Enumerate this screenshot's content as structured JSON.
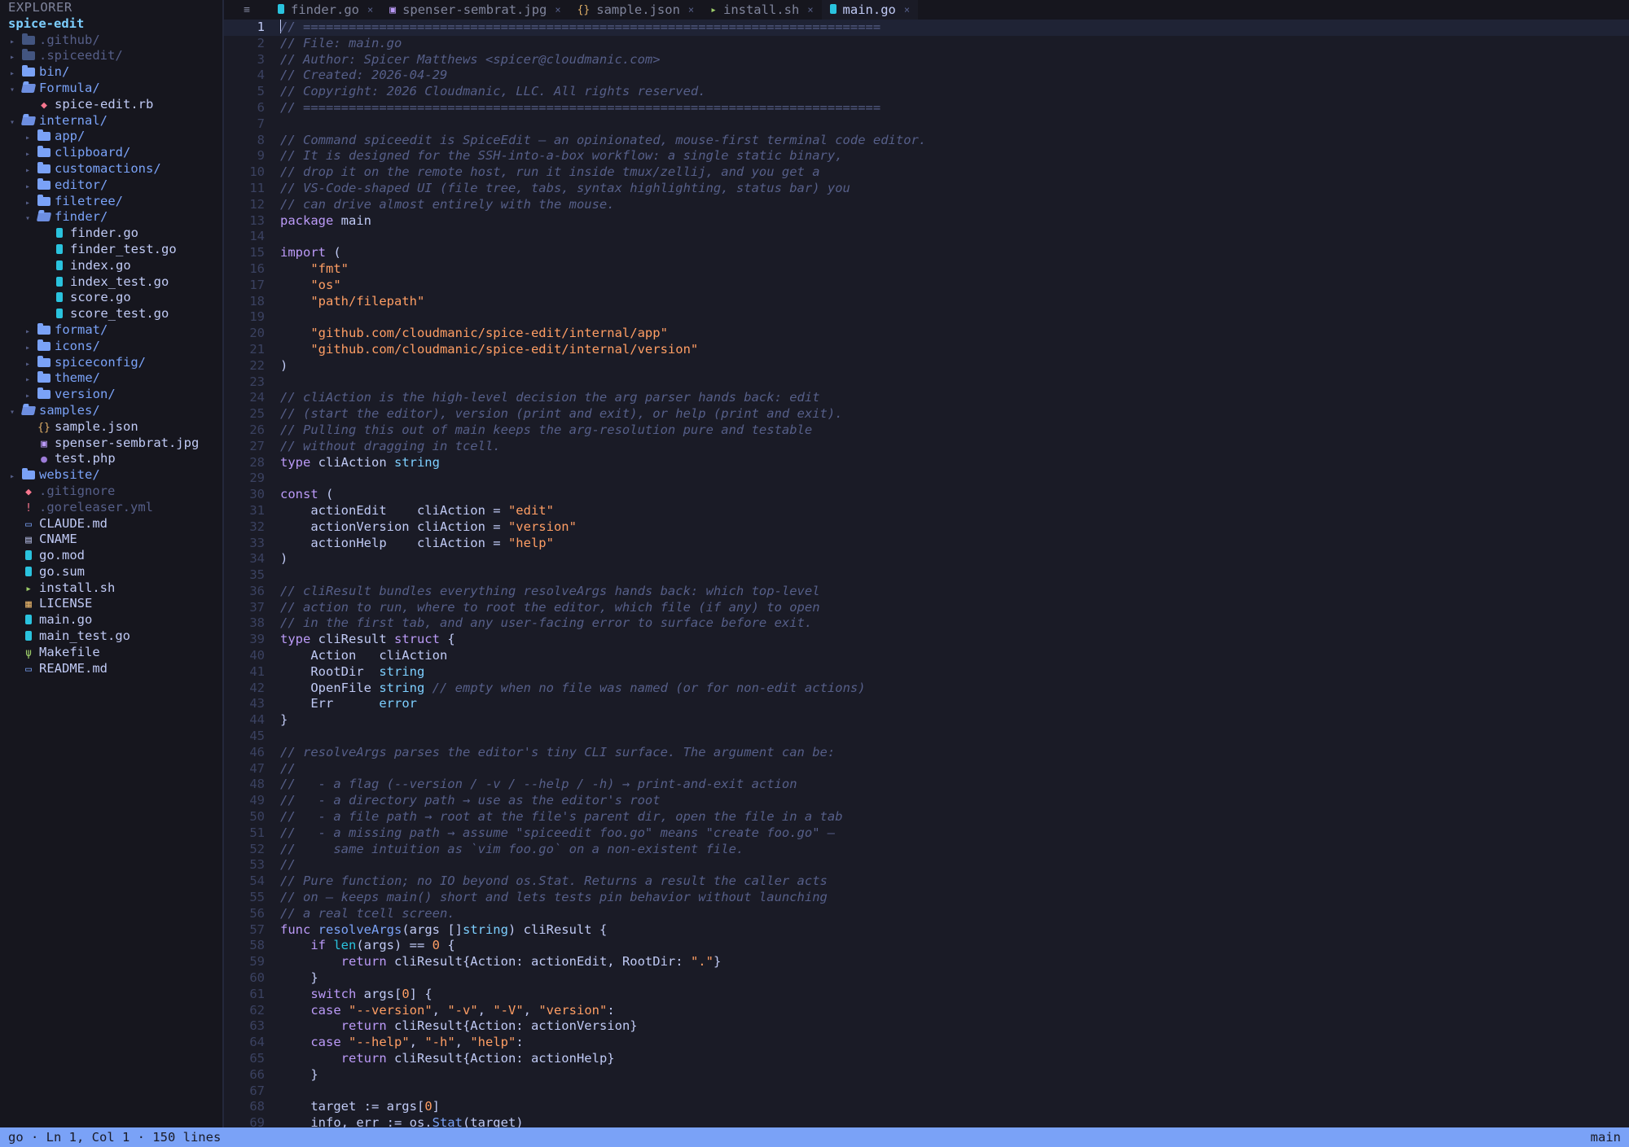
{
  "explorer": {
    "title": "EXPLORER",
    "root": "spice-edit",
    "items": [
      {
        "label": ".github/",
        "kind": "dir",
        "depth": 0,
        "open": false,
        "dim": true
      },
      {
        "label": ".spiceedit/",
        "kind": "dir",
        "depth": 0,
        "open": false,
        "dim": true
      },
      {
        "label": "bin/",
        "kind": "dir",
        "depth": 0,
        "open": false
      },
      {
        "label": "Formula/",
        "kind": "dir",
        "depth": 0,
        "open": true
      },
      {
        "label": "spice-edit.rb",
        "kind": "file",
        "depth": 1,
        "icon": "ruby-icon",
        "color": "#f7768e"
      },
      {
        "label": "internal/",
        "kind": "dir",
        "depth": 0,
        "open": true
      },
      {
        "label": "app/",
        "kind": "dir",
        "depth": 1,
        "open": false
      },
      {
        "label": "clipboard/",
        "kind": "dir",
        "depth": 1,
        "open": false
      },
      {
        "label": "customactions/",
        "kind": "dir",
        "depth": 1,
        "open": false
      },
      {
        "label": "editor/",
        "kind": "dir",
        "depth": 1,
        "open": false
      },
      {
        "label": "filetree/",
        "kind": "dir",
        "depth": 1,
        "open": false
      },
      {
        "label": "finder/",
        "kind": "dir",
        "depth": 1,
        "open": true
      },
      {
        "label": "finder.go",
        "kind": "file",
        "depth": 2,
        "icon": "go-icon",
        "color": "#2ac3de"
      },
      {
        "label": "finder_test.go",
        "kind": "file",
        "depth": 2,
        "icon": "go-icon",
        "color": "#2ac3de"
      },
      {
        "label": "index.go",
        "kind": "file",
        "depth": 2,
        "icon": "go-icon",
        "color": "#2ac3de"
      },
      {
        "label": "index_test.go",
        "kind": "file",
        "depth": 2,
        "icon": "go-icon",
        "color": "#2ac3de"
      },
      {
        "label": "score.go",
        "kind": "file",
        "depth": 2,
        "icon": "go-icon",
        "color": "#2ac3de"
      },
      {
        "label": "score_test.go",
        "kind": "file",
        "depth": 2,
        "icon": "go-icon",
        "color": "#2ac3de"
      },
      {
        "label": "format/",
        "kind": "dir",
        "depth": 1,
        "open": false
      },
      {
        "label": "icons/",
        "kind": "dir",
        "depth": 1,
        "open": false
      },
      {
        "label": "spiceconfig/",
        "kind": "dir",
        "depth": 1,
        "open": false
      },
      {
        "label": "theme/",
        "kind": "dir",
        "depth": 1,
        "open": false
      },
      {
        "label": "version/",
        "kind": "dir",
        "depth": 1,
        "open": false
      },
      {
        "label": "samples/",
        "kind": "dir",
        "depth": 0,
        "open": true
      },
      {
        "label": "sample.json",
        "kind": "file",
        "depth": 1,
        "icon": "json-icon",
        "color": "#e0af68"
      },
      {
        "label": "spenser-sembrat.jpg",
        "kind": "file",
        "depth": 1,
        "icon": "image-icon",
        "color": "#bb9af7"
      },
      {
        "label": "test.php",
        "kind": "file",
        "depth": 1,
        "icon": "php-icon",
        "color": "#9d7cd8"
      },
      {
        "label": "website/",
        "kind": "dir",
        "depth": 0,
        "open": false
      },
      {
        "label": ".gitignore",
        "kind": "file",
        "depth": 0,
        "icon": "git-icon",
        "color": "#f7768e",
        "dim": true
      },
      {
        "label": ".goreleaser.yml",
        "kind": "file",
        "depth": 0,
        "icon": "yaml-icon",
        "color": "#f7768e",
        "dim": true
      },
      {
        "label": "CLAUDE.md",
        "kind": "file",
        "depth": 0,
        "icon": "markdown-icon",
        "color": "#7aa2f7"
      },
      {
        "label": "CNAME",
        "kind": "file",
        "depth": 0,
        "icon": "file-icon",
        "color": "#a9b1d6"
      },
      {
        "label": "go.mod",
        "kind": "file",
        "depth": 0,
        "icon": "go-icon",
        "color": "#2ac3de"
      },
      {
        "label": "go.sum",
        "kind": "file",
        "depth": 0,
        "icon": "go-icon",
        "color": "#2ac3de"
      },
      {
        "label": "install.sh",
        "kind": "file",
        "depth": 0,
        "icon": "terminal-icon",
        "color": "#9ece6a"
      },
      {
        "label": "LICENSE",
        "kind": "file",
        "depth": 0,
        "icon": "license-icon",
        "color": "#e0af68"
      },
      {
        "label": "main.go",
        "kind": "file",
        "depth": 0,
        "icon": "go-icon",
        "color": "#2ac3de"
      },
      {
        "label": "main_test.go",
        "kind": "file",
        "depth": 0,
        "icon": "go-icon",
        "color": "#2ac3de"
      },
      {
        "label": "Makefile",
        "kind": "file",
        "depth": 0,
        "icon": "makefile-icon",
        "color": "#9ece6a"
      },
      {
        "label": "README.md",
        "kind": "file",
        "depth": 0,
        "icon": "markdown-icon",
        "color": "#7aa2f7"
      }
    ]
  },
  "tabs": [
    {
      "label": "finder.go",
      "icon": "go-icon",
      "icon_color": "#2ac3de",
      "close": "×",
      "active": false
    },
    {
      "label": "spenser-sembrat.jpg",
      "icon": "image-icon",
      "icon_color": "#bb9af7",
      "close": "×",
      "active": false
    },
    {
      "label": "sample.json",
      "icon": "json-icon",
      "icon_color": "#e0af68",
      "close": "×",
      "active": false
    },
    {
      "label": "install.sh",
      "icon": "terminal-icon",
      "icon_color": "#9ece6a",
      "close": "×",
      "active": false
    },
    {
      "label": "main.go",
      "icon": "go-icon",
      "icon_color": "#2ac3de",
      "close": "×",
      "active": true
    }
  ],
  "editor": {
    "current_line": 1,
    "lines": [
      [
        [
          "c",
          "// ============================================================================"
        ]
      ],
      [
        [
          "c",
          "// File: main.go"
        ]
      ],
      [
        [
          "c",
          "// Author: Spicer Matthews <spicer@cloudmanic.com>"
        ]
      ],
      [
        [
          "c",
          "// Created: 2026-04-29"
        ]
      ],
      [
        [
          "c",
          "// Copyright: 2026 Cloudmanic, LLC. All rights reserved."
        ]
      ],
      [
        [
          "c",
          "// ============================================================================"
        ]
      ],
      [],
      [
        [
          "c",
          "// Command spiceedit is SpiceEdit — an opinionated, mouse-first terminal code editor."
        ]
      ],
      [
        [
          "c",
          "// It is designed for the SSH-into-a-box workflow: a single static binary,"
        ]
      ],
      [
        [
          "c",
          "// drop it on the remote host, run it inside tmux/zellij, and you get a"
        ]
      ],
      [
        [
          "c",
          "// VS-Code-shaped UI (file tree, tabs, syntax highlighting, status bar) you"
        ]
      ],
      [
        [
          "c",
          "// can drive almost entirely with the mouse."
        ]
      ],
      [
        [
          "k",
          "package"
        ],
        [
          "p",
          " main"
        ]
      ],
      [],
      [
        [
          "k",
          "import"
        ],
        [
          "p",
          " ("
        ]
      ],
      [
        [
          "p",
          "    "
        ],
        [
          "s",
          "\"fmt\""
        ]
      ],
      [
        [
          "p",
          "    "
        ],
        [
          "s",
          "\"os\""
        ]
      ],
      [
        [
          "p",
          "    "
        ],
        [
          "s",
          "\"path/filepath\""
        ]
      ],
      [],
      [
        [
          "p",
          "    "
        ],
        [
          "s",
          "\"github.com/cloudmanic/spice-edit/internal/app\""
        ]
      ],
      [
        [
          "p",
          "    "
        ],
        [
          "s",
          "\"github.com/cloudmanic/spice-edit/internal/version\""
        ]
      ],
      [
        [
          "p",
          ")"
        ]
      ],
      [],
      [
        [
          "c",
          "// cliAction is the high-level decision the arg parser hands back: edit"
        ]
      ],
      [
        [
          "c",
          "// (start the editor), version (print and exit), or help (print and exit)."
        ]
      ],
      [
        [
          "c",
          "// Pulling this out of main keeps the arg-resolution pure and testable"
        ]
      ],
      [
        [
          "c",
          "// without dragging in tcell."
        ]
      ],
      [
        [
          "k",
          "type"
        ],
        [
          "p",
          " cliAction "
        ],
        [
          "t",
          "string"
        ]
      ],
      [],
      [
        [
          "k",
          "const"
        ],
        [
          "p",
          " ("
        ]
      ],
      [
        [
          "p",
          "    actionEdit    cliAction = "
        ],
        [
          "s",
          "\"edit\""
        ]
      ],
      [
        [
          "p",
          "    actionVersion cliAction = "
        ],
        [
          "s",
          "\"version\""
        ]
      ],
      [
        [
          "p",
          "    actionHelp    cliAction = "
        ],
        [
          "s",
          "\"help\""
        ]
      ],
      [
        [
          "p",
          ")"
        ]
      ],
      [],
      [
        [
          "c",
          "// cliResult bundles everything resolveArgs hands back: which top-level"
        ]
      ],
      [
        [
          "c",
          "// action to run, where to root the editor, which file (if any) to open"
        ]
      ],
      [
        [
          "c",
          "// in the first tab, and any user-facing error to surface before exit."
        ]
      ],
      [
        [
          "k",
          "type"
        ],
        [
          "p",
          " cliResult "
        ],
        [
          "k",
          "struct"
        ],
        [
          "p",
          " {"
        ]
      ],
      [
        [
          "p",
          "    Action   cliAction"
        ]
      ],
      [
        [
          "p",
          "    RootDir  "
        ],
        [
          "t",
          "string"
        ]
      ],
      [
        [
          "p",
          "    OpenFile "
        ],
        [
          "t",
          "string"
        ],
        [
          "p",
          " "
        ],
        [
          "c",
          "// empty when no file was named (or for non-edit actions)"
        ]
      ],
      [
        [
          "p",
          "    Err      "
        ],
        [
          "t",
          "error"
        ]
      ],
      [
        [
          "p",
          "}"
        ]
      ],
      [],
      [
        [
          "c",
          "// resolveArgs parses the editor's tiny CLI surface. The argument can be:"
        ]
      ],
      [
        [
          "c",
          "//"
        ]
      ],
      [
        [
          "c",
          "//   - a flag (--version / -v / --help / -h) → print-and-exit action"
        ]
      ],
      [
        [
          "c",
          "//   - a directory path → use as the editor's root"
        ]
      ],
      [
        [
          "c",
          "//   - a file path → root at the file's parent dir, open the file in a tab"
        ]
      ],
      [
        [
          "c",
          "//   - a missing path → assume \"spiceedit foo.go\" means \"create foo.go\" —"
        ]
      ],
      [
        [
          "c",
          "//     same intuition as `vim foo.go` on a non-existent file."
        ]
      ],
      [
        [
          "c",
          "//"
        ]
      ],
      [
        [
          "c",
          "// Pure function; no IO beyond os.Stat. Returns a result the caller acts"
        ]
      ],
      [
        [
          "c",
          "// on — keeps main() short and lets tests pin behavior without launching"
        ]
      ],
      [
        [
          "c",
          "// a real tcell screen."
        ]
      ],
      [
        [
          "k",
          "func"
        ],
        [
          "p",
          " "
        ],
        [
          "f",
          "resolveArgs"
        ],
        [
          "p",
          "(args []"
        ],
        [
          "t",
          "string"
        ],
        [
          "p",
          ") cliResult {"
        ]
      ],
      [
        [
          "p",
          "    "
        ],
        [
          "k",
          "if"
        ],
        [
          "p",
          " "
        ],
        [
          "b",
          "len"
        ],
        [
          "p",
          "(args) == "
        ],
        [
          "n",
          "0"
        ],
        [
          "p",
          " {"
        ]
      ],
      [
        [
          "p",
          "        "
        ],
        [
          "k",
          "return"
        ],
        [
          "p",
          " cliResult{Action: actionEdit, RootDir: "
        ],
        [
          "s",
          "\".\""
        ],
        [
          "p",
          "}"
        ]
      ],
      [
        [
          "p",
          "    }"
        ]
      ],
      [
        [
          "p",
          "    "
        ],
        [
          "k",
          "switch"
        ],
        [
          "p",
          " args["
        ],
        [
          "n",
          "0"
        ],
        [
          "p",
          "] {"
        ]
      ],
      [
        [
          "p",
          "    "
        ],
        [
          "k",
          "case"
        ],
        [
          "p",
          " "
        ],
        [
          "s",
          "\"--version\""
        ],
        [
          "p",
          ", "
        ],
        [
          "s",
          "\"-v\""
        ],
        [
          "p",
          ", "
        ],
        [
          "s",
          "\"-V\""
        ],
        [
          "p",
          ", "
        ],
        [
          "s",
          "\"version\""
        ],
        [
          "p",
          ":"
        ]
      ],
      [
        [
          "p",
          "        "
        ],
        [
          "k",
          "return"
        ],
        [
          "p",
          " cliResult{Action: actionVersion}"
        ]
      ],
      [
        [
          "p",
          "    "
        ],
        [
          "k",
          "case"
        ],
        [
          "p",
          " "
        ],
        [
          "s",
          "\"--help\""
        ],
        [
          "p",
          ", "
        ],
        [
          "s",
          "\"-h\""
        ],
        [
          "p",
          ", "
        ],
        [
          "s",
          "\"help\""
        ],
        [
          "p",
          ":"
        ]
      ],
      [
        [
          "p",
          "        "
        ],
        [
          "k",
          "return"
        ],
        [
          "p",
          " cliResult{Action: actionHelp}"
        ]
      ],
      [
        [
          "p",
          "    }"
        ]
      ],
      [],
      [
        [
          "p",
          "    target := args["
        ],
        [
          "n",
          "0"
        ],
        [
          "p",
          "]"
        ]
      ],
      [
        [
          "p",
          "    info, err := os."
        ],
        [
          "f",
          "Stat"
        ],
        [
          "p",
          "(target)"
        ]
      ]
    ]
  },
  "status": {
    "left": "go · Ln 1, Col 1 · 150 lines",
    "right": "main"
  }
}
